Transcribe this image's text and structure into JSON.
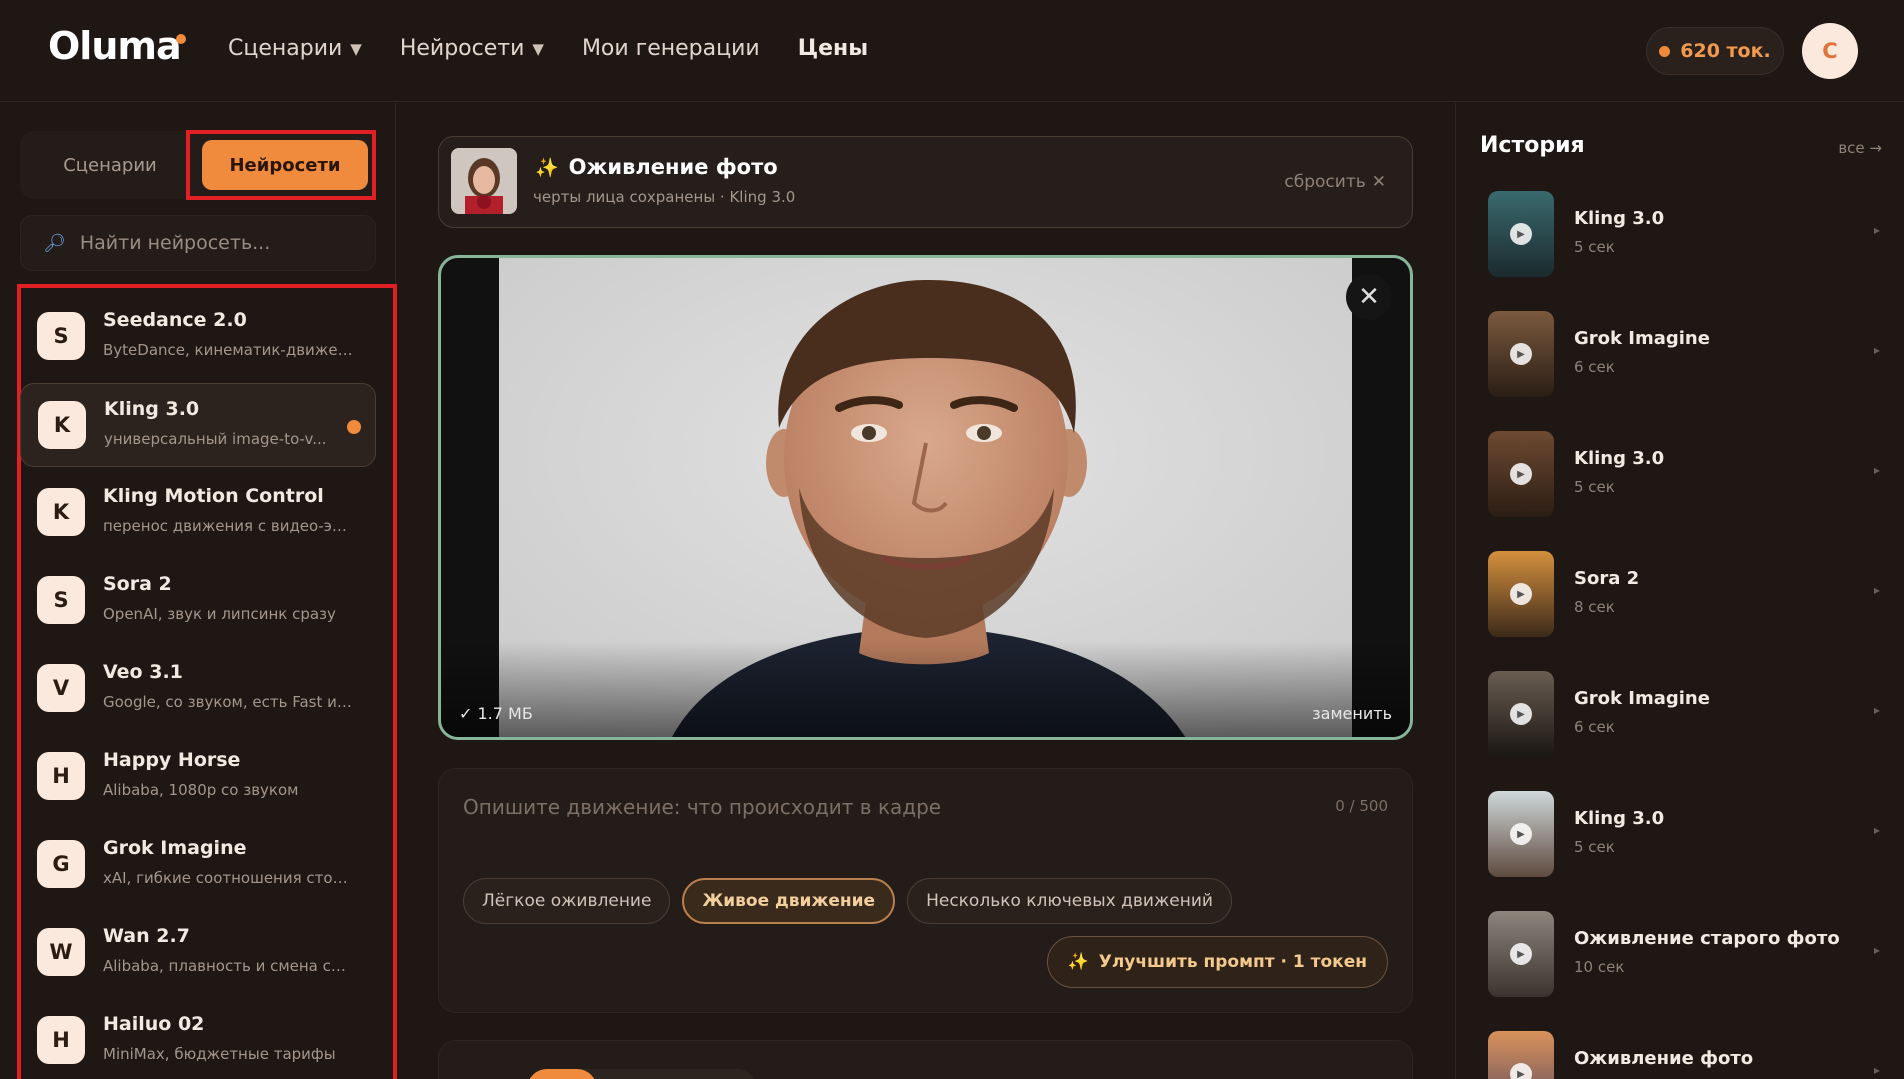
{
  "header": {
    "logo": "Oluma",
    "nav": [
      {
        "label": "Сценарии",
        "dropdown": true
      },
      {
        "label": "Нейросети",
        "dropdown": true
      },
      {
        "label": "Мои генерации",
        "dropdown": false
      },
      {
        "label": "Цены",
        "dropdown": false
      }
    ],
    "tokens": "620 ток.",
    "avatar_initial": "С"
  },
  "sidebar": {
    "tabs": {
      "scenarios": "Сценарии",
      "networks": "Нейросети",
      "active": "networks"
    },
    "search_placeholder": "Найти нейросеть...",
    "models": [
      {
        "badge": "S",
        "name": "Seedance 2.0",
        "desc": "ByteDance, кинематик-движен..."
      },
      {
        "badge": "K",
        "name": "Kling 3.0",
        "desc": "универсальный image-to-v...",
        "active": true
      },
      {
        "badge": "K",
        "name": "Kling Motion Control",
        "desc": "перенос движения с видео-эт..."
      },
      {
        "badge": "S",
        "name": "Sora 2",
        "desc": "OpenAI, звук и липсинк сразу"
      },
      {
        "badge": "V",
        "name": "Veo 3.1",
        "desc": "Google, со звуком, есть Fast и ..."
      },
      {
        "badge": "H",
        "name": "Happy Horse",
        "desc": "Alibaba, 1080p со звуком"
      },
      {
        "badge": "G",
        "name": "Grok Imagine",
        "desc": "xAI, гибкие соотношения сторон"
      },
      {
        "badge": "W",
        "name": "Wan 2.7",
        "desc": "Alibaba, плавность и смена сцен"
      },
      {
        "badge": "H",
        "name": "Hailuo 02",
        "desc": "MiniMax, бюджетные тарифы"
      }
    ]
  },
  "scenario": {
    "title": "Оживление фото",
    "subtitle": "черты лица сохранены · Kling 3.0",
    "reset": "сбросить"
  },
  "upload": {
    "size": "✓ 1.7 МБ",
    "replace": "заменить"
  },
  "prompt": {
    "placeholder": "Опишите движение: что происходит в кадре",
    "counter": "0 / 500",
    "chips": [
      {
        "label": "Лёгкое оживление",
        "selected": false
      },
      {
        "label": "Живое движение",
        "selected": true
      },
      {
        "label": "Несколько ключевых движений",
        "selected": false
      }
    ],
    "improve": "Улучшить промпт · 1 токен"
  },
  "history": {
    "title": "История",
    "all": "все →",
    "items": [
      {
        "name": "Kling 3.0",
        "duration": "5 сек",
        "thumb_colors": [
          "#3a6a6e",
          "#1b2a2e"
        ]
      },
      {
        "name": "Grok Imagine",
        "duration": "6 сек",
        "thumb_colors": [
          "#7a5a3e",
          "#2a1d15"
        ]
      },
      {
        "name": "Kling 3.0",
        "duration": "5 сек",
        "thumb_colors": [
          "#6e4a32",
          "#2b1d14"
        ]
      },
      {
        "name": "Sora 2",
        "duration": "8 сек",
        "thumb_colors": [
          "#d4903e",
          "#3d2a1a"
        ]
      },
      {
        "name": "Grok Imagine",
        "duration": "6 сек",
        "thumb_colors": [
          "#6a5d52",
          "#1a1612"
        ]
      },
      {
        "name": "Kling 3.0",
        "duration": "5 сек",
        "thumb_colors": [
          "#cfd8da",
          "#5e4a3e"
        ]
      },
      {
        "name": "Оживление старого фото",
        "duration": "10 сек",
        "thumb_colors": [
          "#8c857c",
          "#3a342e"
        ]
      },
      {
        "name": "Оживление фото",
        "duration": "",
        "thumb_colors": [
          "#d9925a",
          "#5a4a5e"
        ]
      }
    ]
  },
  "colors": {
    "accent": "#f08a3c",
    "background": "#1e1714",
    "highlight_box": "#e11f25",
    "upload_border": "#86b59a"
  }
}
